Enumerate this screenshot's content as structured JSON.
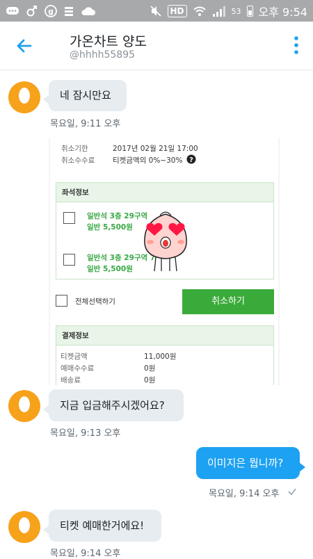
{
  "status_bar": {
    "left_icons": [
      "chat-icon",
      "male-icon",
      "g-icon",
      "bars-icon",
      "cloud-icon"
    ],
    "mute_icon": "mute-icon",
    "hd_label": "HD",
    "wifi_icon": "wifi-icon",
    "signal_icon": "signal-icon",
    "battery_percent": "53",
    "time": "오후 9:54"
  },
  "header": {
    "back_icon": "back-arrow-icon",
    "title": "가온차트 양도",
    "handle": "@hhhh55895",
    "more_icon": "more-vertical-icon"
  },
  "messages": [
    {
      "direction": "incoming",
      "text": "네 잠시만요",
      "time": "목요일, 9:11 오후"
    },
    {
      "direction": "incoming",
      "type": "image"
    },
    {
      "direction": "incoming",
      "text": "지금 입금해주시겠어요?",
      "time": "목요일, 9:13 오후"
    },
    {
      "direction": "outgoing",
      "text": "이미지은 뭡니까?",
      "time": "목요일, 9:14 오후",
      "status_icon": "check-icon"
    },
    {
      "direction": "incoming",
      "text": "티켓 예매한거에요!",
      "time": "목요일, 9:14 오후"
    }
  ],
  "image": {
    "cancel_deadline_label": "취소기한",
    "cancel_deadline_value": "2017년 02월 21일 17:00",
    "cancel_fee_label": "취소수수료",
    "cancel_fee_value": "티켓금액의 0%~30%",
    "help_icon": "question-icon",
    "seat_section_title": "좌석정보",
    "seats": [
      {
        "line1": "일반석 3층 29구역",
        "line2": "일반 5,500원"
      },
      {
        "line1": "일반석 3층 29구역 7",
        "line2": "일반 5,500원"
      }
    ],
    "select_all": "전체선택하기",
    "cancel_button": "취소하기",
    "payment_section_title": "결제정보",
    "payment_rows": [
      {
        "label": "티켓금액",
        "value": "11,000원"
      },
      {
        "label": "예매수수료",
        "value": "0원"
      },
      {
        "label": "배송료",
        "value": "0원"
      }
    ],
    "sticker": "peach-heart-eyes-sticker"
  },
  "colors": {
    "accent": "#1da1f2",
    "incoming_bubble": "#e6ecf0",
    "avatar": "#f7a21b",
    "status_bar": "#a8a9ab",
    "ticket_green": "#3aab3a"
  }
}
